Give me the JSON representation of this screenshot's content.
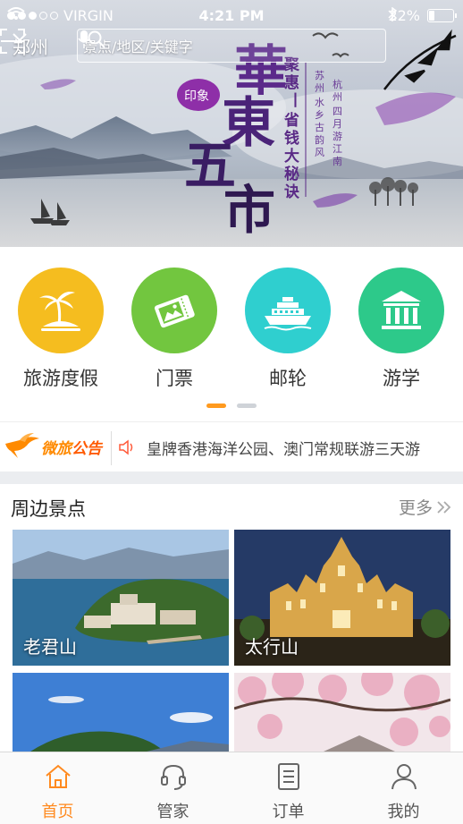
{
  "status_bar": {
    "carrier": "VIRGIN",
    "time": "4:21 PM",
    "battery": "22%"
  },
  "header": {
    "city": "郑州",
    "search_placeholder": "景点/地区/关键字"
  },
  "banner": {
    "title": "華東五市",
    "seal_text": "印象",
    "slogan": "聚惠丨省钱大秘诀",
    "tagline_1": "苏州 水乡古韵风",
    "tagline_2": "杭州 四月游江南"
  },
  "categories": [
    {
      "label": "旅游度假",
      "color": "#f5bd1f",
      "icon": "palm-island-icon"
    },
    {
      "label": "门票",
      "color": "#72c63f",
      "icon": "ticket-icon"
    },
    {
      "label": "邮轮",
      "color": "#2fcfcf",
      "icon": "cruise-ship-icon"
    },
    {
      "label": "游学",
      "color": "#2dc98a",
      "icon": "museum-icon"
    }
  ],
  "pager": {
    "active_color": "#ff9a1f",
    "inactive_color": "#cfd3d8"
  },
  "notice": {
    "logo_part1": "微旅",
    "logo_part2": "公告",
    "text": "皇牌香港海洋公园、澳门常规联游三天游"
  },
  "nearby": {
    "title": "周边景点",
    "more": "更多",
    "cards": [
      {
        "name": "老君山"
      },
      {
        "name": "太行山"
      },
      {
        "name": ""
      },
      {
        "name": ""
      }
    ]
  },
  "tabbar": {
    "items": [
      {
        "label": "首页",
        "icon": "home-icon",
        "active": true
      },
      {
        "label": "管家",
        "icon": "headset-icon",
        "active": false
      },
      {
        "label": "订单",
        "icon": "order-list-icon",
        "active": false
      },
      {
        "label": "我的",
        "icon": "user-icon",
        "active": false
      }
    ],
    "active_color": "#ff8a1f"
  }
}
